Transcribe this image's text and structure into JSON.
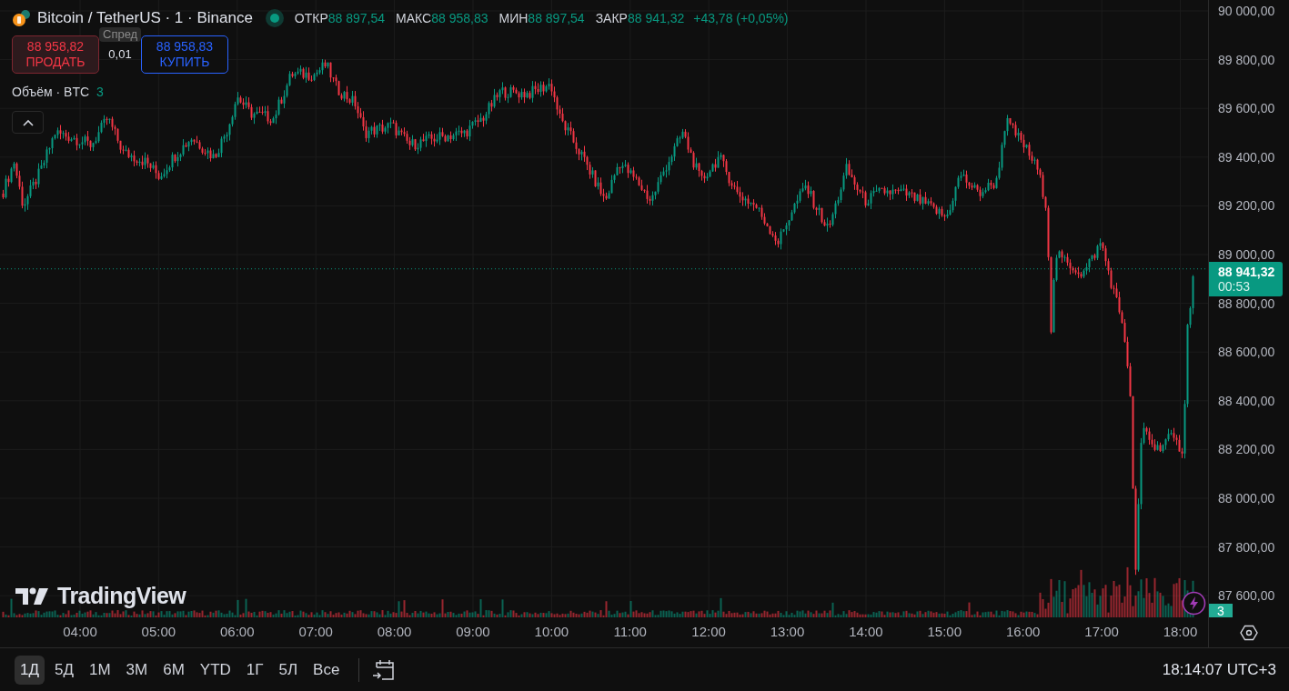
{
  "legend": {
    "title": "Bitcoin / TetherUS · 1 · Binance",
    "market_open": true,
    "ohlc": [
      {
        "label": "ОТКР",
        "value": "88 897,54"
      },
      {
        "label": "МАКС",
        "value": "88 958,83"
      },
      {
        "label": "МИН",
        "value": "88 897,54"
      },
      {
        "label": "ЗАКР",
        "value": "88 941,32"
      }
    ],
    "change": "+43,78 (+0,05%)"
  },
  "spread_tooltip": "Спред",
  "trade": {
    "sell": {
      "price": "88 958,82",
      "label": "ПРОДАТЬ"
    },
    "spread": "0,01",
    "buy": {
      "price": "88 958,83",
      "label": "КУПИТЬ"
    }
  },
  "volume_legend": {
    "label": "Объём · BTC",
    "value": "3"
  },
  "logo": "TradingView",
  "price_axis": [
    "90 000,00",
    "89 800,00",
    "89 600,00",
    "89 400,00",
    "89 200,00",
    "89 000,00",
    "88 800,00",
    "88 600,00",
    "88 400,00",
    "88 200,00",
    "88 000,00",
    "87 800,00",
    "87 600,00"
  ],
  "price_tag": {
    "price": "88 941,32",
    "countdown": "00:53"
  },
  "alerts_badge": "3",
  "time_axis": [
    "04:00",
    "05:00",
    "06:00",
    "07:00",
    "08:00",
    "09:00",
    "10:00",
    "11:00",
    "12:00",
    "13:00",
    "14:00",
    "15:00",
    "16:00",
    "17:00",
    "18:00"
  ],
  "ranges": [
    {
      "label": "1Д",
      "selected": true
    },
    {
      "label": "5Д",
      "selected": false
    },
    {
      "label": "1М",
      "selected": false
    },
    {
      "label": "3М",
      "selected": false
    },
    {
      "label": "6М",
      "selected": false
    },
    {
      "label": "YTD",
      "selected": false
    },
    {
      "label": "1Г",
      "selected": false
    },
    {
      "label": "5Л",
      "selected": false
    },
    {
      "label": "Все",
      "selected": false
    }
  ],
  "clock": "18:14:07 UTC+3"
}
